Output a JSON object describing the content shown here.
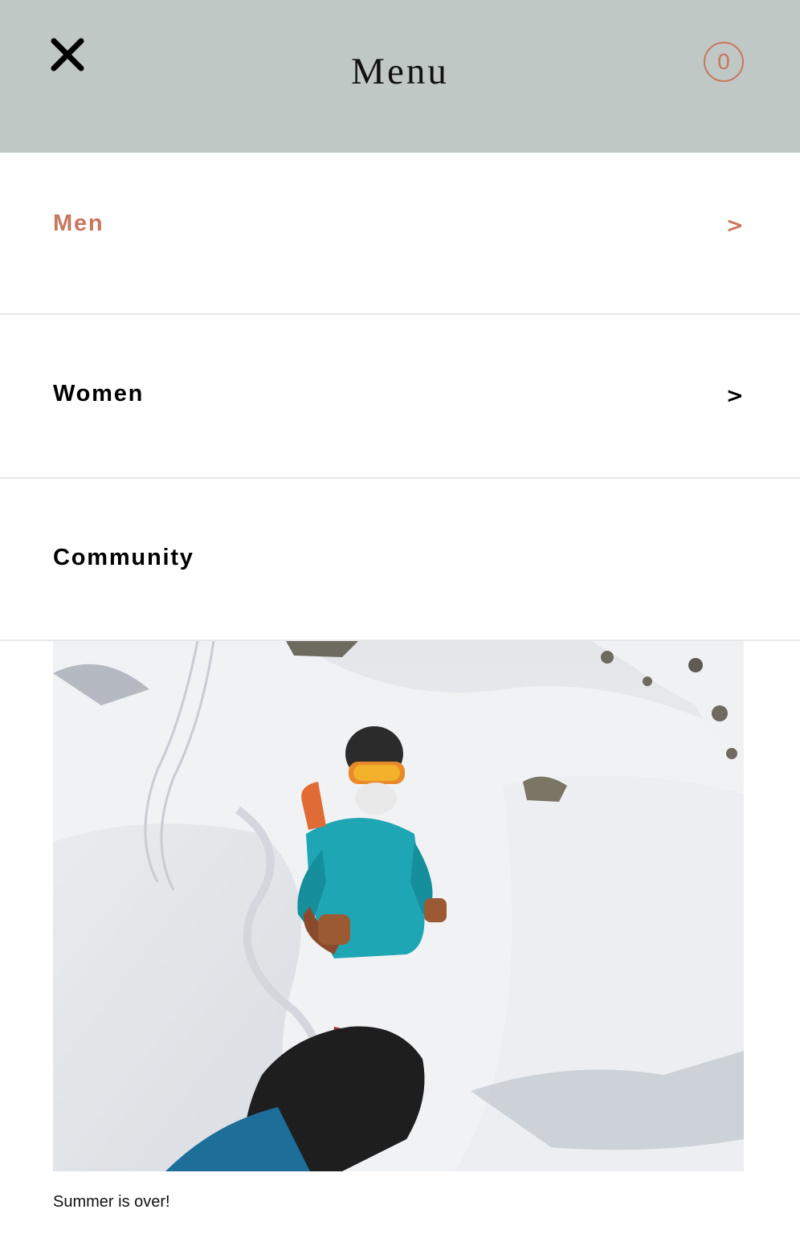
{
  "header": {
    "title": "Menu",
    "close_icon": "close-icon",
    "cart_count": "0",
    "background_color": "#bfc8c4",
    "accent_color": "#c9765e"
  },
  "nav": {
    "items": [
      {
        "label": "Men",
        "chevron": ">",
        "active": true
      },
      {
        "label": "Women",
        "chevron": ">",
        "active": false
      },
      {
        "label": "Community",
        "chevron": "",
        "active": false
      }
    ]
  },
  "promo": {
    "caption": "Summer is over!"
  }
}
